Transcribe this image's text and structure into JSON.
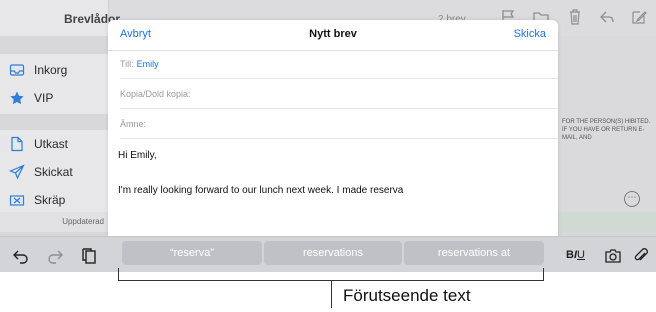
{
  "sidebar": {
    "title": "Brevlådor",
    "items": [
      {
        "label": "Inkorg",
        "icon": "inbox-icon"
      },
      {
        "label": "VIP",
        "icon": "star-icon"
      },
      {
        "label": "Utkast",
        "icon": "draft-icon"
      },
      {
        "label": "Skickat",
        "icon": "sent-icon"
      },
      {
        "label": "Skräp",
        "icon": "junk-icon"
      }
    ],
    "updated_label": "Uppdaterad"
  },
  "background_mail": {
    "header_text": "2 brev",
    "legal_text": "FOR THE PERSON(S) HIBITED. IF YOU HAVE OR RETURN E-MAIL, AND"
  },
  "compose": {
    "cancel_label": "Avbryt",
    "title": "Nytt brev",
    "send_label": "Skicka",
    "to_label": "Till:",
    "to_value": "Emily",
    "cc_label": "Kopia/Dold kopia:",
    "subject_label": "Ämne:",
    "greeting": "Hi Emily,",
    "body_text": "I'm really looking forward to our lunch next week. I made reserva"
  },
  "predictive": {
    "suggestions": [
      "“reserva”",
      "reservations",
      "reservations at"
    ]
  },
  "format_label": {
    "b": "B",
    "i": "I",
    "u": "U"
  },
  "callout": {
    "label": "Förutseende text"
  },
  "colors": {
    "accent": "#1a73e8",
    "star": "#2f7fd6",
    "prediction_bg": "#bfc1c6"
  }
}
